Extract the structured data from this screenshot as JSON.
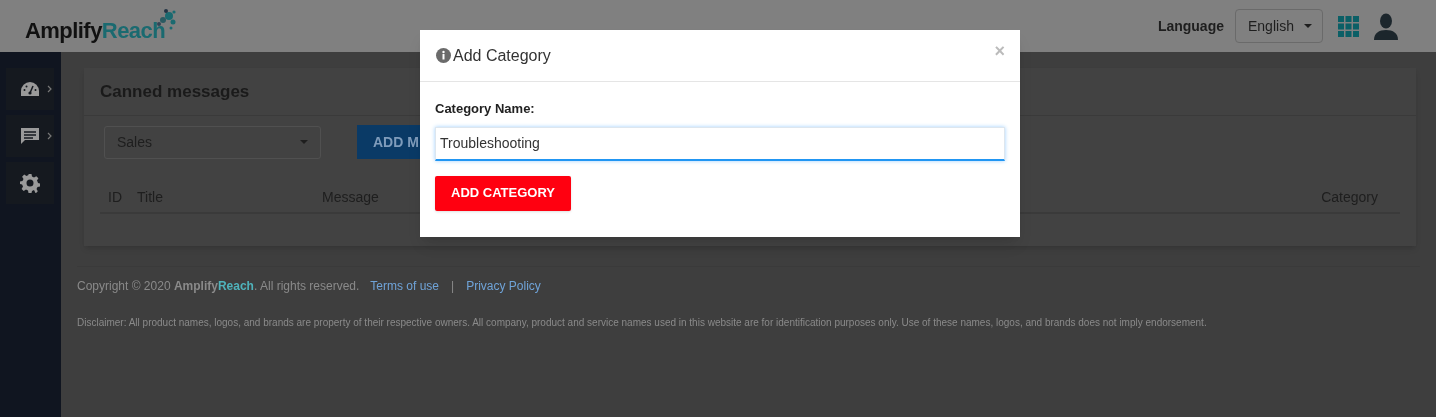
{
  "header": {
    "logo": {
      "part_1": "Amplify",
      "part_2": "Reach"
    },
    "language_label": "Language",
    "language_select": "English"
  },
  "sidebar": {
    "items": [
      {
        "kind": "gauge",
        "has_arrow": true
      },
      {
        "kind": "chat",
        "has_arrow": true
      },
      {
        "kind": "gear",
        "has_arrow": false
      }
    ]
  },
  "card": {
    "title": "Canned messages",
    "category_select": "Sales",
    "add_button": "ADD M",
    "columns": [
      "ID",
      "Title",
      "Message",
      "Category"
    ]
  },
  "footer": {
    "copyright": "Copyright © 2020 **Amplify**",
    "brand_suffix": "Reach",
    "copyright_end": ". All rights reserved.",
    "links": [
      "Terms of use",
      "Privacy Policy"
    ],
    "separator": "|",
    "disclaimer": "Disclaimer: All product names, logos, and brands are property of their respective owners. All company, product and service names used in this website are for identification purposes only. Use of these names, logos, and brands does not imply endorsement."
  },
  "modal": {
    "title": "Add Category",
    "close": "×",
    "field_label": "Category Name:",
    "field_value": "Troubleshooting",
    "submit": "ADD CATEGORY"
  }
}
